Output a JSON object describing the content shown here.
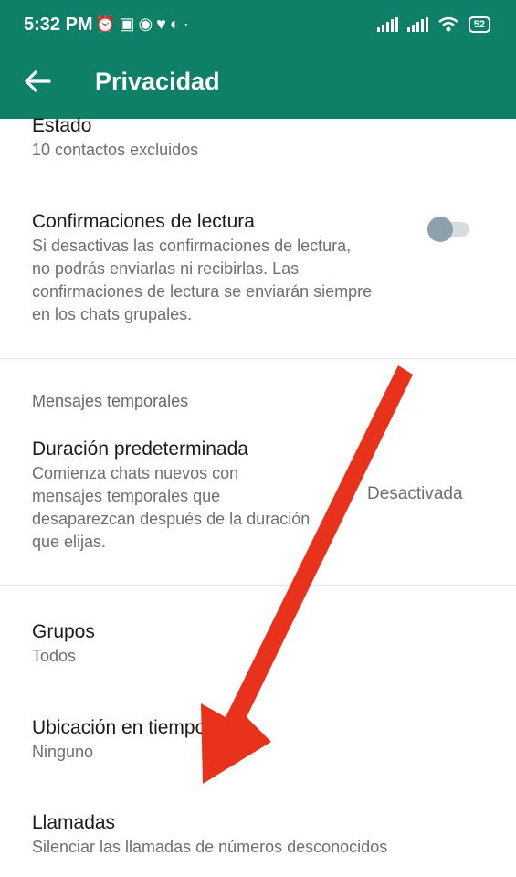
{
  "status_bar": {
    "time": "5:32 PM",
    "battery": "52",
    "left_icons": [
      "alarm-icon",
      "nfc-icon",
      "messenger-icon",
      "heart-icon",
      "app-icon",
      "dot-icon"
    ],
    "right_icons": [
      "signal-icon",
      "signal-icon",
      "wifi-icon",
      "battery-icon"
    ]
  },
  "appbar": {
    "title": "Privacidad",
    "back_icon": "arrow-left-icon",
    "color": "#0f8068"
  },
  "items": [
    {
      "label": "Estado",
      "sub": "10 contactos excluidos"
    },
    {
      "label": "Confirmaciones de lectura",
      "sub_lines": [
        "Si desactivas las confirmaciones de lectura,",
        "no podrás enviarlas ni recibirlas. Las",
        "confirmaciones de lectura se enviarán siempre",
        "en los chats grupales."
      ],
      "toggle_on": false
    },
    {
      "section": "Mensajes temporales"
    },
    {
      "label": "Duración predeterminada",
      "sub_lines": [
        "Comienza chats nuevos con",
        "mensajes temporales que",
        "desaparezcan después de la duración",
        "que elijas."
      ],
      "value": "Desactivada"
    },
    {
      "label": "Grupos",
      "sub": "Todos"
    },
    {
      "label": "Ubicación en tiempo real",
      "sub": "Ninguno"
    },
    {
      "label": "Llamadas",
      "sub": "Silenciar las llamadas de números desconocidos"
    }
  ],
  "annotation": {
    "type": "red-arrow",
    "color": "#e8321c"
  }
}
